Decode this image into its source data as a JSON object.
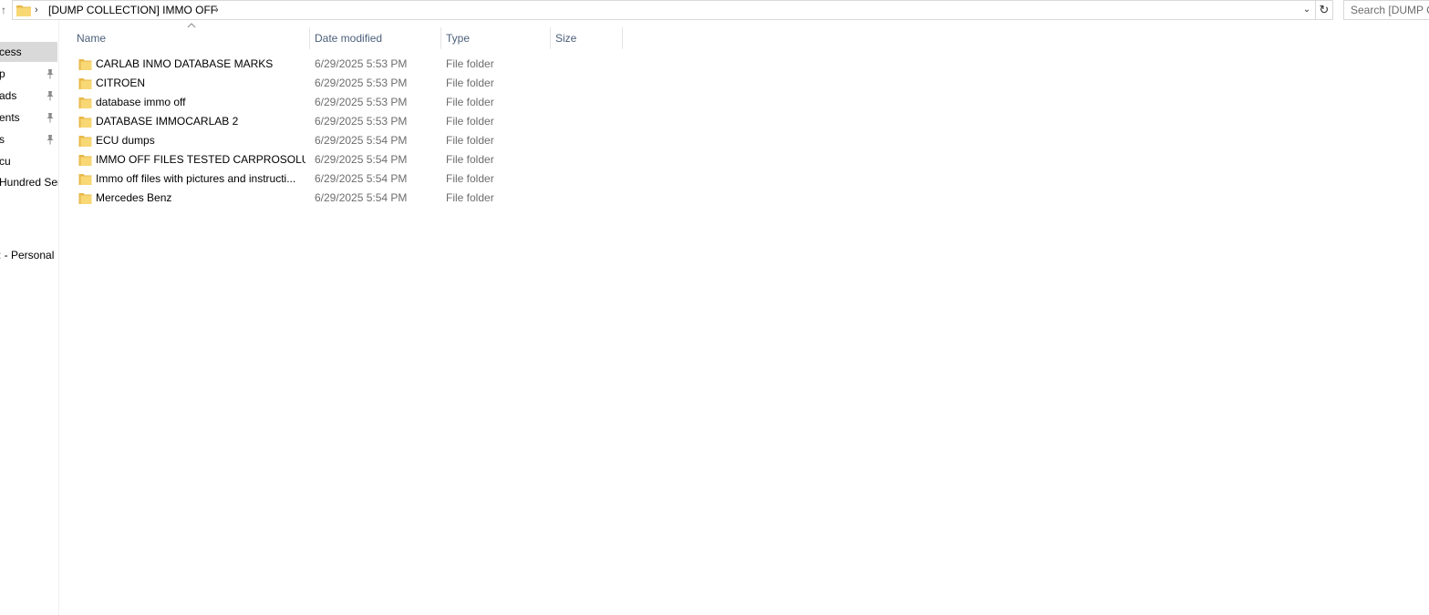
{
  "address_bar": {
    "path_segment": "[DUMP COLLECTION] IMMO OFF",
    "search_placeholder": "Search [DUMP C"
  },
  "nav_pane": {
    "items": [
      {
        "label": "cess",
        "pinned": false,
        "selected": true
      },
      {
        "label": "p",
        "pinned": true,
        "selected": false
      },
      {
        "label": "ads",
        "pinned": true,
        "selected": false
      },
      {
        "label": "ents",
        "pinned": true,
        "selected": false
      },
      {
        "label": "s",
        "pinned": true,
        "selected": false
      },
      {
        "label": "cu",
        "pinned": false,
        "selected": false
      },
      {
        "label": "Hundred Ser",
        "pinned": false,
        "selected": false
      },
      {
        "label": ": - Personal",
        "pinned": false,
        "selected": false
      }
    ]
  },
  "columns": {
    "name": "Name",
    "date": "Date modified",
    "type": "Type",
    "size": "Size"
  },
  "files": [
    {
      "name": "CARLAB INMO DATABASE MARKS",
      "date": "6/29/2025 5:53 PM",
      "type": "File folder",
      "size": ""
    },
    {
      "name": "CITROEN",
      "date": "6/29/2025 5:53 PM",
      "type": "File folder",
      "size": ""
    },
    {
      "name": "database immo off",
      "date": "6/29/2025 5:53 PM",
      "type": "File folder",
      "size": ""
    },
    {
      "name": "DATABASE IMMOCARLAB 2",
      "date": "6/29/2025 5:53 PM",
      "type": "File folder",
      "size": ""
    },
    {
      "name": "ECU dumps",
      "date": "6/29/2025 5:54 PM",
      "type": "File folder",
      "size": ""
    },
    {
      "name": "IMMO OFF FILES TESTED CARPROSOLUTI...",
      "date": "6/29/2025 5:54 PM",
      "type": "File folder",
      "size": ""
    },
    {
      "name": "Immo off files with pictures and instructi...",
      "date": "6/29/2025 5:54 PM",
      "type": "File folder",
      "size": ""
    },
    {
      "name": "Mercedes Benz",
      "date": "6/29/2025 5:54 PM",
      "type": "File folder",
      "size": ""
    }
  ],
  "icons": {
    "folder": "folder-icon",
    "pin": "pin-icon",
    "up": "up-arrow-icon",
    "refresh": "refresh-icon",
    "dropdown": "chevron-down-icon",
    "breadcrumb_separator": "chevron-right-icon",
    "sort": "sort-ascending-icon"
  },
  "colors": {
    "folder_fill": "#f8d775",
    "folder_tab": "#e8b84a",
    "header_text": "#4c607a",
    "secondary_text": "#6d6d6d",
    "selection": "#d9d9d9"
  }
}
